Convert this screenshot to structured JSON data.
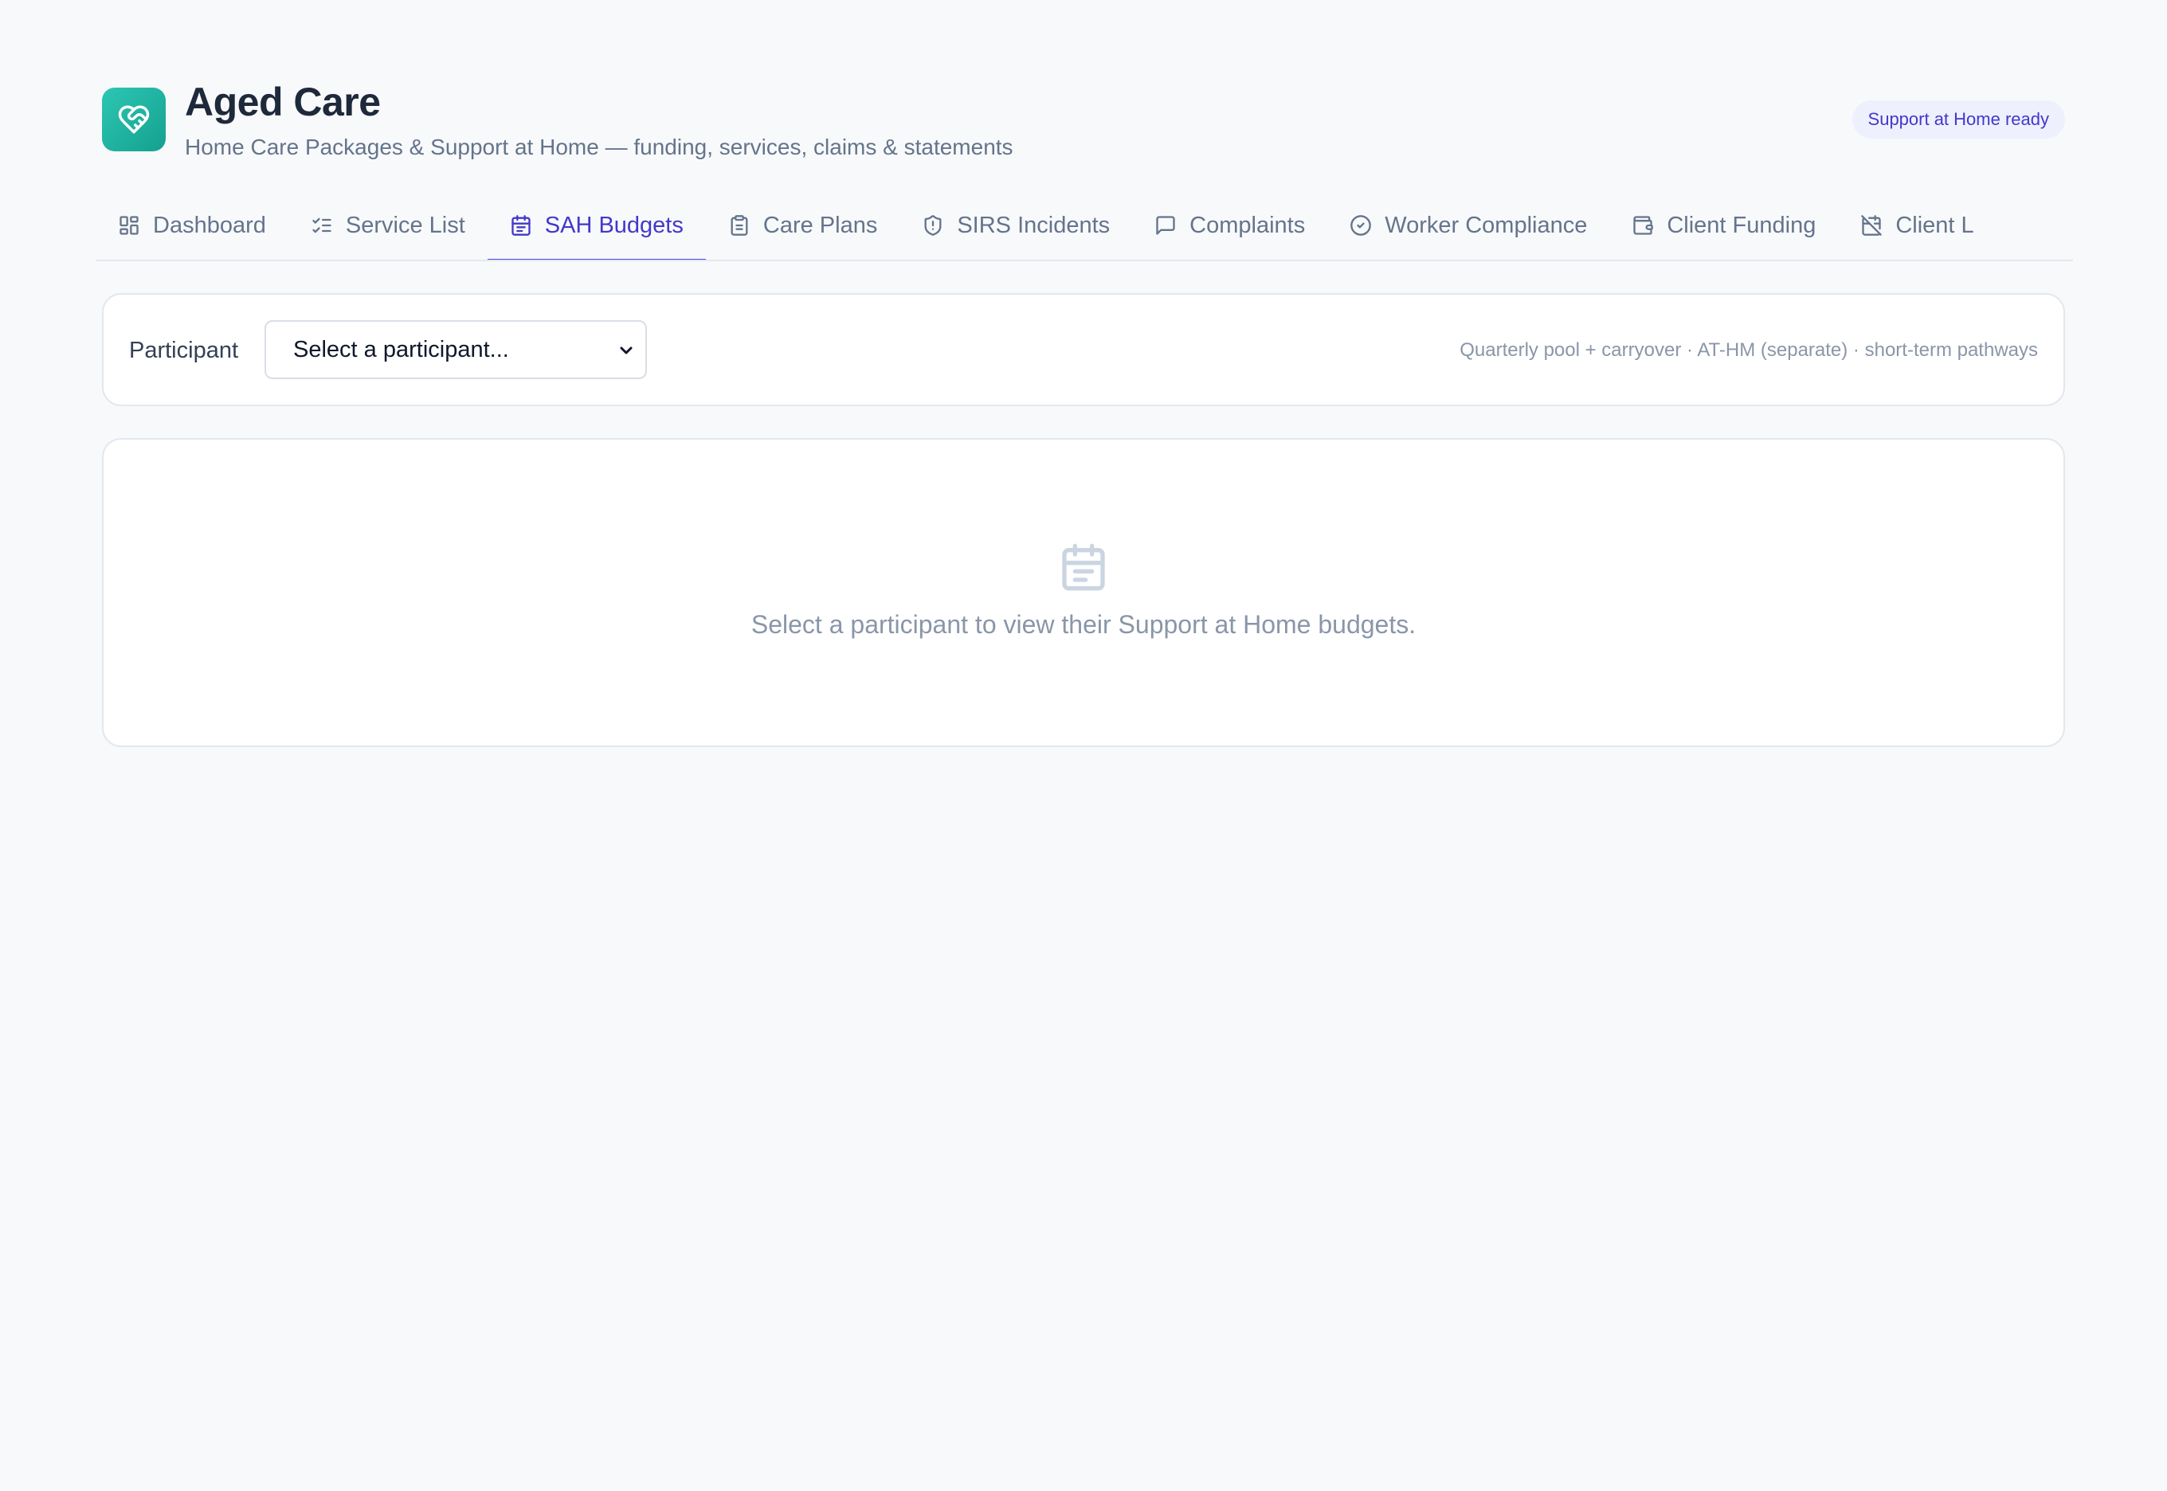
{
  "app": {
    "title": "Aged Care",
    "subtitle": "Home Care Packages & Support at Home — funding, services, claims & statements",
    "badge": "Support at Home ready",
    "logo_icon": "heart-handshake-icon",
    "brand_color": "#1fb5a2"
  },
  "tabs": [
    {
      "label": "Dashboard",
      "icon": "layout-grid-icon",
      "active": false
    },
    {
      "label": "Service List",
      "icon": "list-checks-icon",
      "active": false
    },
    {
      "label": "SAH Budgets",
      "icon": "calendar-icon",
      "active": true
    },
    {
      "label": "Care Plans",
      "icon": "clipboard-icon",
      "active": false
    },
    {
      "label": "SIRS Incidents",
      "icon": "shield-alert-icon",
      "active": false
    },
    {
      "label": "Complaints",
      "icon": "message-square-icon",
      "active": false
    },
    {
      "label": "Worker Compliance",
      "icon": "circle-check-icon",
      "active": false
    },
    {
      "label": "Client Funding",
      "icon": "wallet-icon",
      "active": false
    },
    {
      "label": "Client L",
      "icon": "calendar-off-icon",
      "active": false
    }
  ],
  "filter": {
    "label": "Participant",
    "select_value": "Select a participant...",
    "hint": "Quarterly pool + carryover · AT-HM (separate) · short-term pathways"
  },
  "empty_state": {
    "icon": "calendar-icon",
    "message": "Select a participant to view their Support at Home budgets."
  },
  "colors": {
    "accent": "#4f46e5",
    "badge_bg": "#eef0fe",
    "muted_text": "#8a96a8"
  }
}
